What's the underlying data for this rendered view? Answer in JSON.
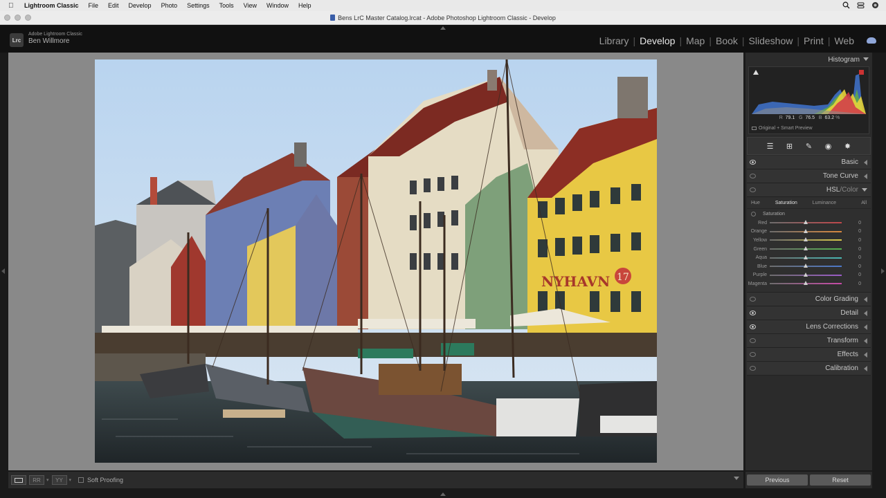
{
  "menubar": {
    "app": "Lightroom Classic",
    "items": [
      "File",
      "Edit",
      "Develop",
      "Photo",
      "Settings",
      "Tools",
      "View",
      "Window",
      "Help"
    ]
  },
  "window": {
    "title": "Bens LrC Master Catalog.lrcat - Adobe Photoshop Lightroom Classic - Develop"
  },
  "identity": {
    "product": "Adobe Lightroom Classic",
    "user": "Ben Willmore",
    "logo": "Lrc"
  },
  "modules": {
    "items": [
      "Library",
      "Develop",
      "Map",
      "Book",
      "Slideshow",
      "Print",
      "Web"
    ],
    "active": "Develop"
  },
  "histogram": {
    "title": "Histogram",
    "r_label": "R",
    "r_value": "79.1",
    "g_label": "G",
    "g_value": "76.5",
    "b_label": "B",
    "b_value": "63.2",
    "unit": "%",
    "preview": "Original + Smart Preview"
  },
  "panels": {
    "basic": "Basic",
    "tone_curve": "Tone Curve",
    "hsl": "HSL",
    "hsl_sep": " / ",
    "color": "Color",
    "color_grading": "Color Grading",
    "detail": "Detail",
    "lens": "Lens Corrections",
    "transform": "Transform",
    "effects": "Effects",
    "calibration": "Calibration"
  },
  "hsl": {
    "tabs": [
      "Hue",
      "Saturation",
      "Luminance"
    ],
    "all": "All",
    "section": "Saturation",
    "rows": [
      {
        "label": "Red",
        "value": "0",
        "color": "#c0474a"
      },
      {
        "label": "Orange",
        "value": "0",
        "color": "#d8873e"
      },
      {
        "label": "Yellow",
        "value": "0",
        "color": "#d8c84a"
      },
      {
        "label": "Green",
        "value": "0",
        "color": "#54b34f"
      },
      {
        "label": "Aqua",
        "value": "0",
        "color": "#48b7b2"
      },
      {
        "label": "Blue",
        "value": "0",
        "color": "#4c78c9"
      },
      {
        "label": "Purple",
        "value": "0",
        "color": "#9b5bc8"
      },
      {
        "label": "Magenta",
        "value": "0",
        "color": "#c74aa7"
      }
    ]
  },
  "toolbar": {
    "soft_proofing": "Soft Proofing",
    "compare1": "RR",
    "compare2": "YY"
  },
  "buttons": {
    "previous": "Previous",
    "reset": "Reset"
  },
  "photo": {
    "sign": "NYHAVN",
    "number": "17"
  }
}
